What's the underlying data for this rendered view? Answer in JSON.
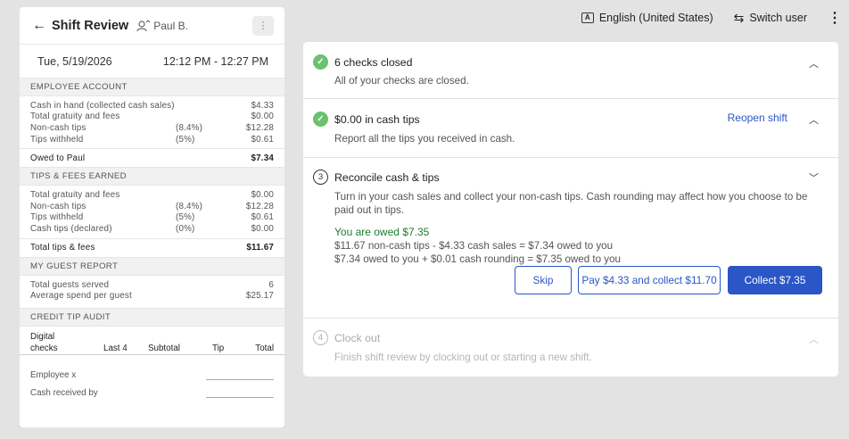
{
  "receipt": {
    "title": "Shift Review",
    "user": "Paul B.",
    "date": "Tue, 5/19/2026",
    "time_range": "12:12 PM - 12:27 PM",
    "employee_account": {
      "header": "EMPLOYEE ACCOUNT",
      "rows": [
        {
          "label": "Cash in hand (collected cash sales)",
          "pct": "",
          "amount": "$4.33"
        },
        {
          "label": "Total gratuity and fees",
          "pct": "",
          "amount": "$0.00"
        },
        {
          "label": "Non-cash tips",
          "pct": "(8.4%)",
          "amount": "$12.28"
        },
        {
          "label": "Tips withheld",
          "pct": "(5%)",
          "amount": "$0.61"
        }
      ],
      "total_label": "Owed to Paul",
      "total_amount": "$7.34"
    },
    "tips_fees": {
      "header": "TIPS & FEES EARNED",
      "rows": [
        {
          "label": "Total gratuity and fees",
          "pct": "",
          "amount": "$0.00"
        },
        {
          "label": "Non-cash tips",
          "pct": "(8.4%)",
          "amount": "$12.28"
        },
        {
          "label": "Tips withheld",
          "pct": "(5%)",
          "amount": "$0.61"
        },
        {
          "label": "Cash tips (declared)",
          "pct": "(0%)",
          "amount": "$0.00"
        }
      ],
      "total_label": "Total tips & fees",
      "total_amount": "$11.67"
    },
    "guest_report": {
      "header": "MY GUEST REPORT",
      "rows": [
        {
          "label": "Total guests served",
          "pct": "",
          "amount": "6"
        },
        {
          "label": "Average spend per guest",
          "pct": "",
          "amount": "$25.17"
        }
      ]
    },
    "credit_audit": {
      "header": "CREDIT TIP AUDIT",
      "label": "Digital",
      "columns": [
        "checks",
        "Last 4",
        "Subtotal",
        "Tip",
        "Total"
      ]
    },
    "signatures": [
      "Employee x",
      "Cash received by"
    ]
  },
  "topbar": {
    "language": "English (United States)",
    "switch_user": "Switch user"
  },
  "steps": {
    "closed": {
      "title": "6 checks closed",
      "desc": "All of your checks are closed."
    },
    "cash_tips": {
      "title": "$0.00 in cash tips",
      "desc": "Report all the tips you received in cash.",
      "reopen": "Reopen shift"
    },
    "reconcile": {
      "number": "3",
      "title": "Reconcile cash & tips",
      "desc": "Turn in your cash sales and collect your non-cash tips. Cash rounding may affect how you choose to be paid out in tips.",
      "owed": "You are owed $7.35",
      "calc_line1": "$11.67 non-cash tips - $4.33 cash sales = $7.34 owed to you",
      "calc_line2": "$7.34 owed to you + $0.01 cash rounding = $7.35 owed to you",
      "skip": "Skip",
      "pay_collect": "Pay $4.33 and collect $11.70",
      "collect": "Collect $7.35"
    },
    "clock_out": {
      "number": "4",
      "title": "Clock out",
      "desc": "Finish shift review by clocking out or starting a new shift."
    }
  }
}
